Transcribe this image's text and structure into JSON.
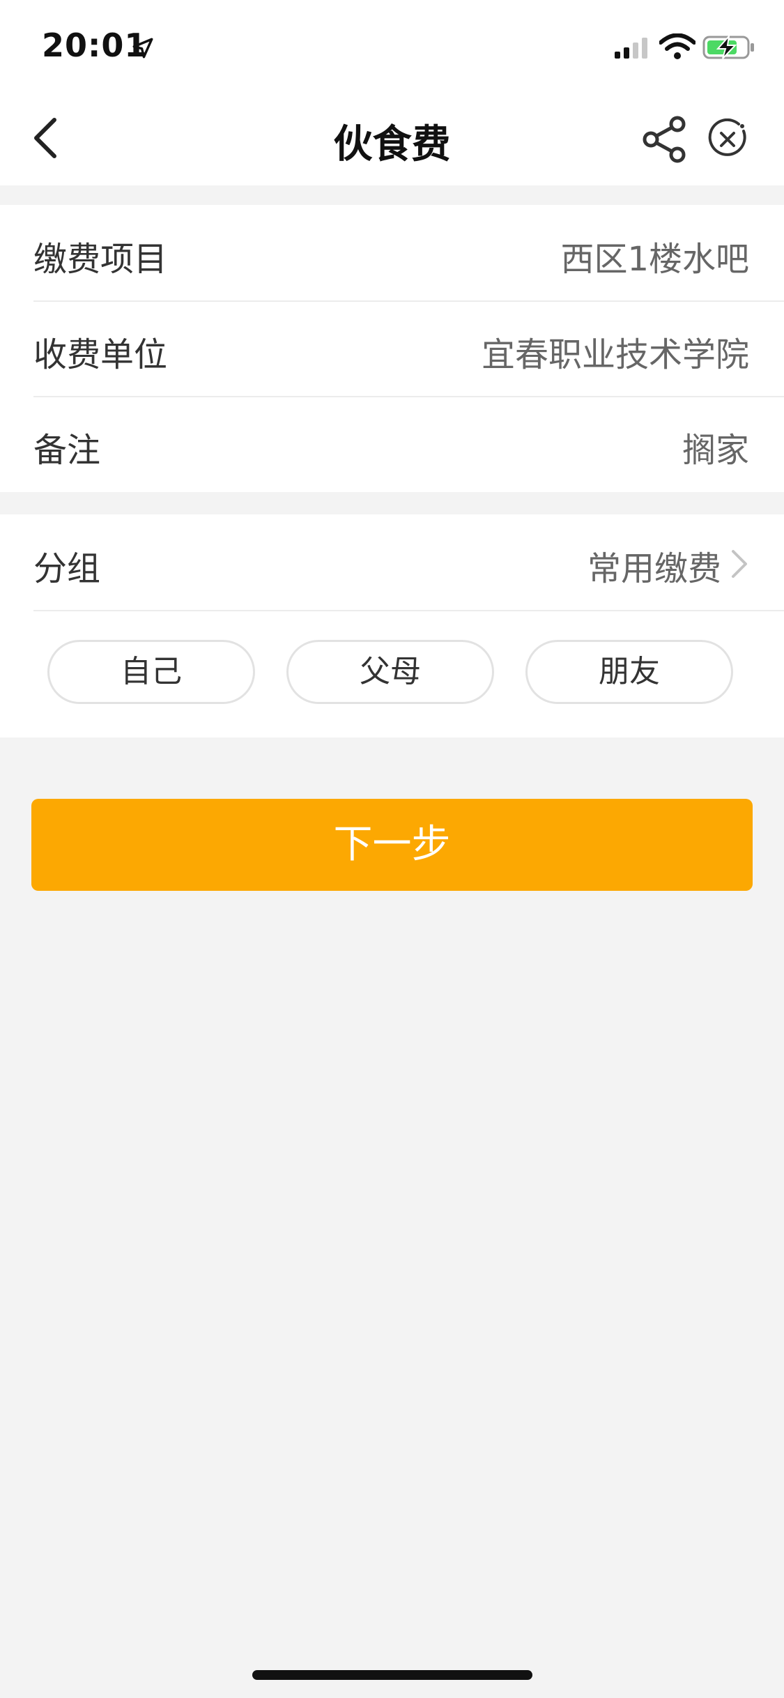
{
  "status_bar": {
    "time": "20:01",
    "icons": [
      "location-arrow-icon",
      "cellular-signal-icon",
      "wifi-icon",
      "battery-charging-icon"
    ],
    "battery_color": "#4cd964"
  },
  "nav": {
    "title": "伙食费",
    "icons": [
      "chevron-left-icon",
      "share-icon",
      "close-circle-icon"
    ]
  },
  "details": {
    "rows": [
      {
        "label": "缴费项目",
        "value": "西区1楼水吧"
      },
      {
        "label": "收费单位",
        "value": "宜春职业技术学院"
      },
      {
        "label": "备注",
        "value": "搁家"
      }
    ]
  },
  "group": {
    "label": "分组",
    "value": "常用缴费",
    "tags": [
      "自己",
      "父母",
      "朋友"
    ]
  },
  "actions": {
    "next_label": "下一步",
    "next_color": "#fca802"
  },
  "theme": {
    "background": "#f3f3f3",
    "card": "#ffffff"
  }
}
